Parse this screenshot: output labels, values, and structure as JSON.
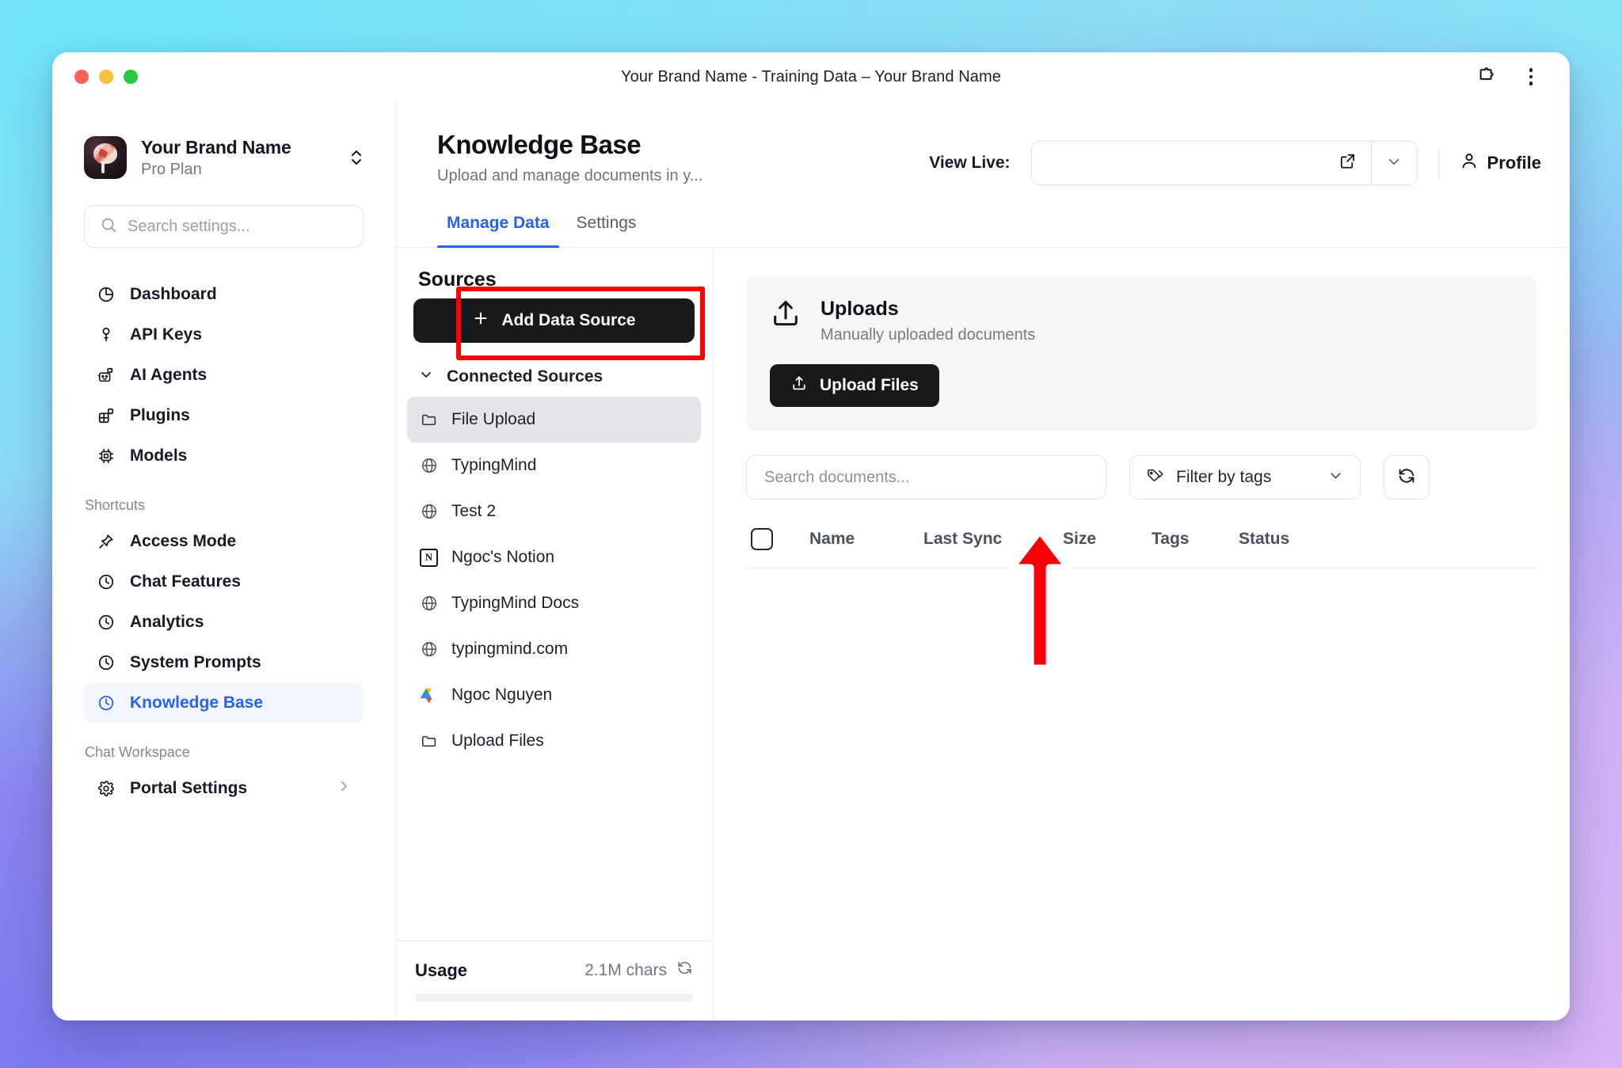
{
  "window": {
    "title": "Your Brand Name - Training Data – Your Brand Name",
    "traffic": {
      "close": "close",
      "minimize": "minimize",
      "zoom": "zoom"
    },
    "extensions_icon": "puzzle-piece-icon",
    "menu_icon": "kebab-menu-icon"
  },
  "sidebar": {
    "brand": {
      "name": "Your Brand Name",
      "plan": "Pro Plan",
      "switcher_icon": "chevron-up-down-icon"
    },
    "search": {
      "placeholder": "Search settings...",
      "value": ""
    },
    "nav": [
      {
        "label": "Dashboard",
        "icon": "pie-chart-icon",
        "active": false
      },
      {
        "label": "API Keys",
        "icon": "key-icon",
        "active": false
      },
      {
        "label": "AI Agents",
        "icon": "robot-icon",
        "active": false
      },
      {
        "label": "Plugins",
        "icon": "blocks-icon",
        "active": false
      },
      {
        "label": "Models",
        "icon": "cpu-chip-icon",
        "active": false
      }
    ],
    "shortcuts_section": "Shortcuts",
    "shortcuts": [
      {
        "label": "Access Mode",
        "icon": "pin-icon",
        "active": false
      },
      {
        "label": "Chat Features",
        "icon": "clock-icon",
        "active": false
      },
      {
        "label": "Analytics",
        "icon": "clock-icon",
        "active": false
      },
      {
        "label": "System Prompts",
        "icon": "clock-icon",
        "active": false
      },
      {
        "label": "Knowledge Base",
        "icon": "clock-icon",
        "active": true
      }
    ],
    "workspace_section": "Chat Workspace",
    "workspace": [
      {
        "label": "Portal Settings",
        "icon": "gear-icon",
        "chevron": "chevron-right-icon"
      }
    ]
  },
  "header": {
    "title": "Knowledge Base",
    "subtitle": "Upload and manage documents in y...",
    "view_live_label": "View Live:",
    "view_live_value": "",
    "external_link_icon": "external-link-icon",
    "dropdown_icon": "chevron-down-icon",
    "profile_label": "Profile",
    "profile_icon": "user-icon"
  },
  "tabs": [
    {
      "label": "Manage Data",
      "active": true
    },
    {
      "label": "Settings",
      "active": false
    }
  ],
  "sources": {
    "title": "Sources",
    "add_button": "Add Data Source",
    "add_button_icon": "plus-icon",
    "connected_header": "Connected Sources",
    "connected_chevron": "chevron-down-icon",
    "items": [
      {
        "label": "File Upload",
        "icon": "folder-icon",
        "selected": true
      },
      {
        "label": "TypingMind",
        "icon": "globe-icon",
        "selected": false
      },
      {
        "label": "Test 2",
        "icon": "globe-icon",
        "selected": false
      },
      {
        "label": "Ngoc's Notion",
        "icon": "notion-icon",
        "selected": false
      },
      {
        "label": "TypingMind Docs",
        "icon": "globe-icon",
        "selected": false
      },
      {
        "label": "typingmind.com",
        "icon": "globe-icon",
        "selected": false
      },
      {
        "label": "Ngoc Nguyen",
        "icon": "google-drive-icon",
        "selected": false
      },
      {
        "label": "Upload Files",
        "icon": "folder-icon",
        "selected": false
      }
    ],
    "usage_label": "Usage",
    "usage_value": "2.1M chars",
    "usage_refresh_icon": "refresh-icon",
    "usage_percent": 0
  },
  "documents": {
    "uploads_title": "Uploads",
    "uploads_subtitle": "Manually uploaded documents",
    "uploads_icon": "upload-icon",
    "upload_button": "Upload Files",
    "upload_button_icon": "upload-icon",
    "search_placeholder": "Search documents...",
    "search_value": "",
    "filter_label": "Filter by tags",
    "filter_icon": "tags-icon",
    "filter_chevron": "chevron-down-icon",
    "refresh_icon": "refresh-icon",
    "columns": [
      "Name",
      "Last Sync",
      "Size",
      "Tags",
      "Status"
    ],
    "rows": []
  },
  "annotations": {
    "highlight_color": "#fb0007",
    "highlight_target": "Add Data Source",
    "arrow_color": "#fb0007",
    "arrow_target": "Upload Files"
  }
}
